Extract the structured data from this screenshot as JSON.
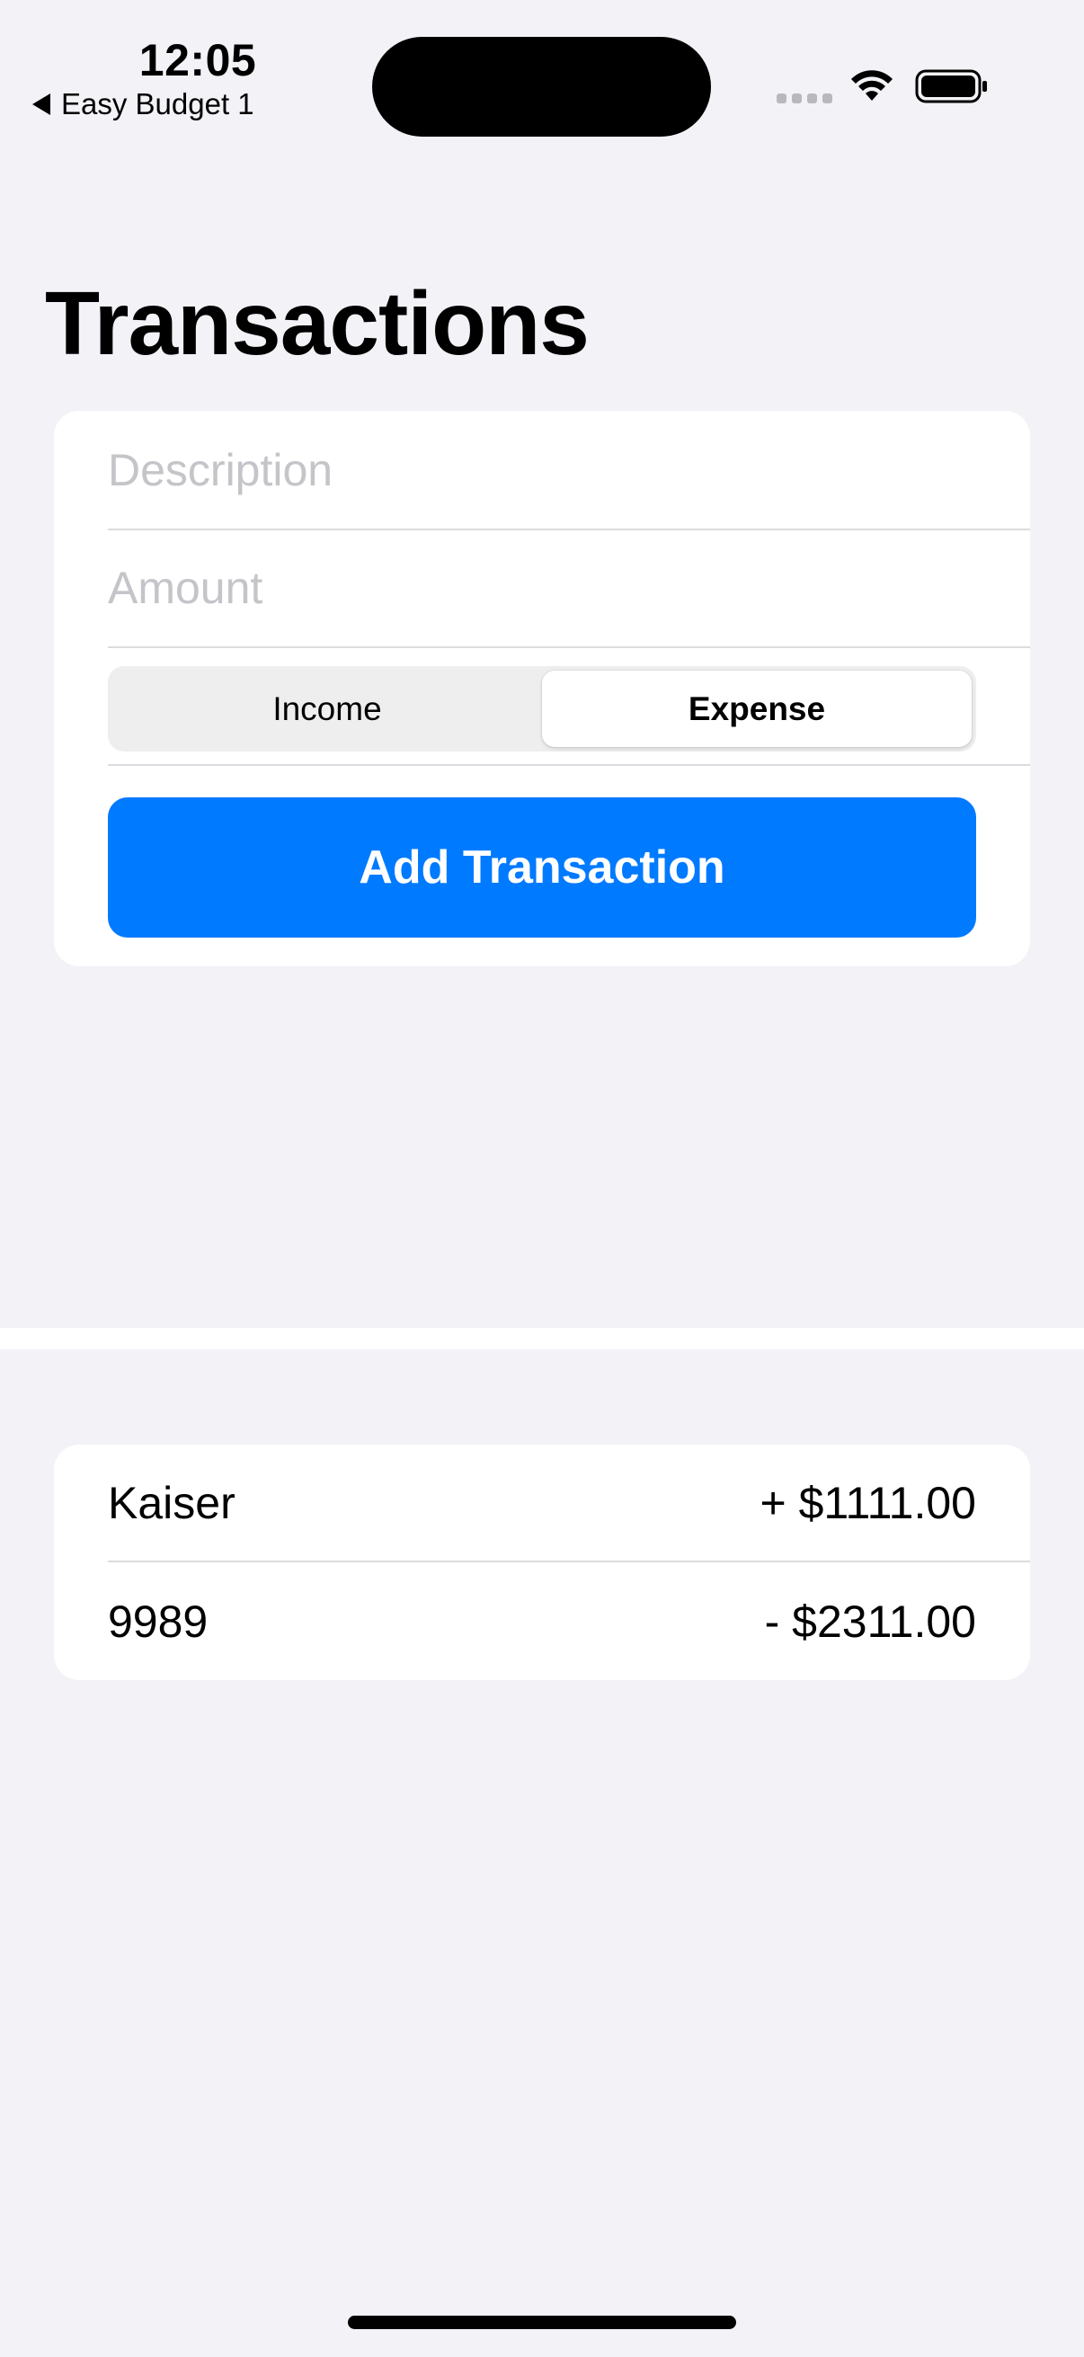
{
  "status_bar": {
    "time": "12:05",
    "back_app": "Easy Budget 1"
  },
  "header": {
    "title": "Transactions"
  },
  "form": {
    "description_placeholder": "Description",
    "amount_placeholder": "Amount",
    "description_value": "",
    "amount_value": "",
    "type_options": [
      "Income",
      "Expense"
    ],
    "selected_type": "Expense",
    "add_button_label": "Add Transaction"
  },
  "transactions": [
    {
      "description": "Kaiser",
      "amount": "+ $1111.00"
    },
    {
      "description": "9989",
      "amount": "- $2311.00"
    }
  ],
  "colors": {
    "accent": "#007aff",
    "background": "#f2f2f7",
    "card": "#ffffff",
    "placeholder": "#c4c4c9"
  }
}
